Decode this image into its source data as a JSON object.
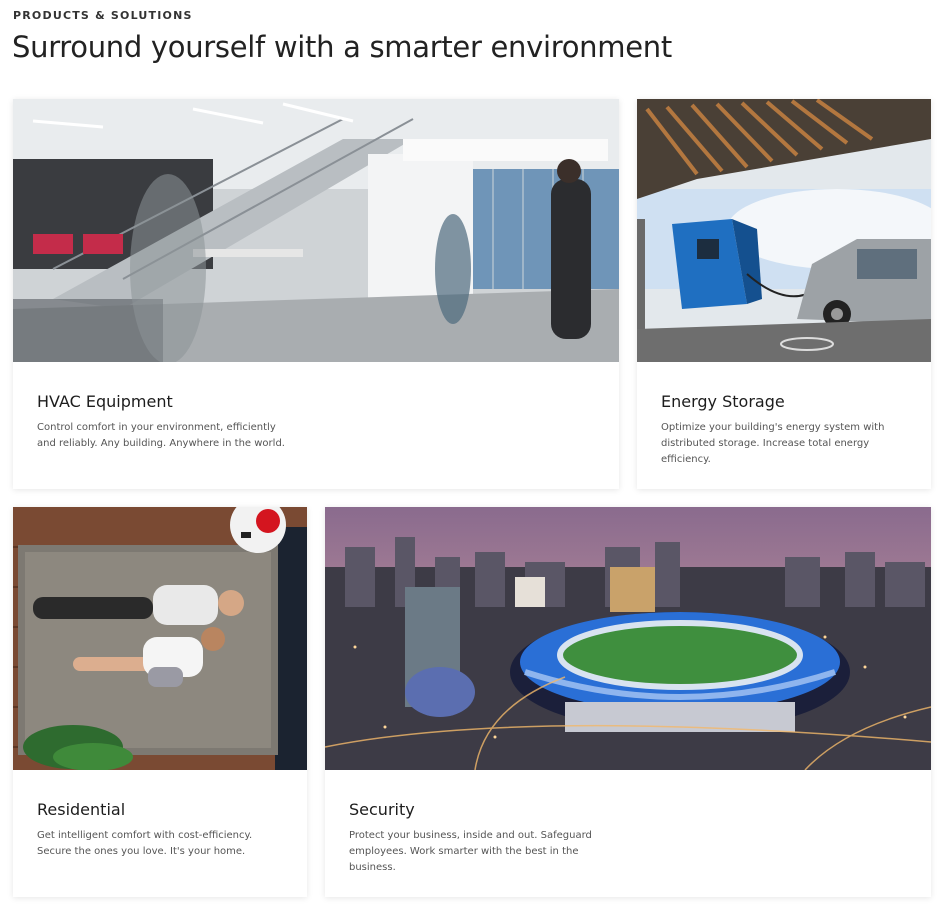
{
  "section": {
    "eyebrow": "PRODUCTS & SOLUTIONS",
    "headline": "Surround yourself with a smarter environment"
  },
  "cards": [
    {
      "title": "HVAC Equipment",
      "description": "Control comfort in your environment, efficiently and reliably. Any building. Anywhere in the world."
    },
    {
      "title": "Energy Storage",
      "description": "Optimize your building's energy system with distributed storage. Increase total energy efficiency."
    },
    {
      "title": "Residential",
      "description": "Get intelligent comfort with cost-efficiency. Secure the ones you love. It's your home."
    },
    {
      "title": "Security",
      "description": "Protect your business, inside and out. Safeguard employees. Work smarter with the best in the business."
    }
  ],
  "colors": {
    "background": "#ffffff",
    "text_primary": "#1d1d1d",
    "text_secondary": "#555555",
    "stadium_blue": "#2a6fd6",
    "charger_blue": "#1f6fc1"
  }
}
